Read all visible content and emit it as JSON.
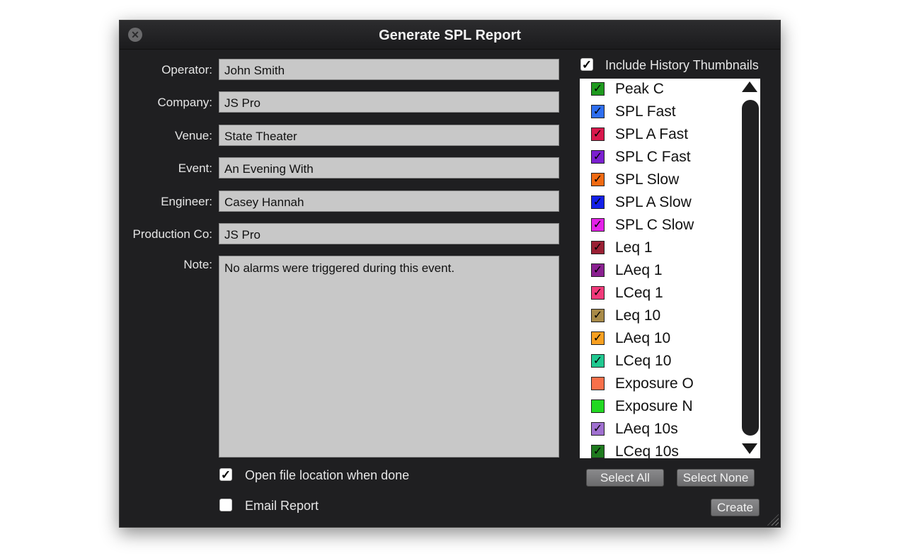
{
  "window": {
    "title": "Generate SPL Report"
  },
  "form": {
    "fields": [
      {
        "label": "Operator:",
        "value": "John Smith"
      },
      {
        "label": "Company:",
        "value": "JS Pro"
      },
      {
        "label": "Venue:",
        "value": "State Theater"
      },
      {
        "label": "Event:",
        "value": "An Evening With"
      },
      {
        "label": "Engineer:",
        "value": "Casey Hannah"
      },
      {
        "label": "Production Co:",
        "value": "JS Pro"
      }
    ],
    "note": {
      "label": "Note:",
      "value": "No alarms were triggered during this event."
    },
    "open_file_location": {
      "label": "Open file location when done",
      "checked": true
    },
    "email_report": {
      "label": "Email Report",
      "checked": false
    }
  },
  "history": {
    "include_thumbnails": {
      "label": "Include History Thumbnails",
      "checked": true
    },
    "items": [
      {
        "label": "Peak C",
        "color": "#1e9a1e",
        "checked": true
      },
      {
        "label": "SPL Fast",
        "color": "#2f6ff0",
        "checked": true
      },
      {
        "label": "SPL A Fast",
        "color": "#d8184c",
        "checked": true
      },
      {
        "label": "SPL C Fast",
        "color": "#7b1fd0",
        "checked": true
      },
      {
        "label": "SPL Slow",
        "color": "#f06a12",
        "checked": true
      },
      {
        "label": "SPL A Slow",
        "color": "#1420e8",
        "checked": true
      },
      {
        "label": "SPL C Slow",
        "color": "#e420e8",
        "checked": true
      },
      {
        "label": "Leq 1",
        "color": "#9a2034",
        "checked": true
      },
      {
        "label": "LAeq 1",
        "color": "#8a2090",
        "checked": true
      },
      {
        "label": "LCeq 1",
        "color": "#f03a7a",
        "checked": true
      },
      {
        "label": "Leq 10",
        "color": "#a88a48",
        "checked": true
      },
      {
        "label": "LAeq 10",
        "color": "#f8a020",
        "checked": true
      },
      {
        "label": "LCeq 10",
        "color": "#20c890",
        "checked": true
      },
      {
        "label": "Exposure O",
        "color": "#f8704a",
        "checked": false
      },
      {
        "label": "Exposure N",
        "color": "#22d822",
        "checked": false
      },
      {
        "label": "LAeq 10s",
        "color": "#a070d0",
        "checked": true
      },
      {
        "label": "LCeq 10s",
        "color": "#1e7a1e",
        "checked": true
      }
    ],
    "select_all_label": "Select All",
    "select_none_label": "Select None"
  },
  "actions": {
    "create_label": "Create"
  }
}
